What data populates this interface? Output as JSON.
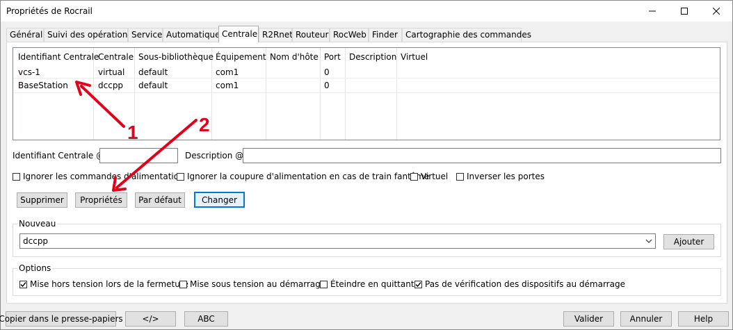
{
  "window": {
    "title": "Propriétés de Rocrail"
  },
  "tabs": [
    {
      "label": "Général"
    },
    {
      "label": "Suivi des opérations"
    },
    {
      "label": "Service"
    },
    {
      "label": "Automatique"
    },
    {
      "label": "Centrale",
      "active": true
    },
    {
      "label": "R2Rnet"
    },
    {
      "label": "Routeur"
    },
    {
      "label": "RocWeb"
    },
    {
      "label": "Finder"
    },
    {
      "label": "Cartographie des commandes"
    }
  ],
  "table": {
    "headers": [
      "Identifiant Centrale",
      "Centrale",
      "Sous-bibliothèque",
      "Équipement",
      "Nom d'hôte",
      "Port",
      "Description",
      "Virtuel"
    ],
    "rows": [
      {
        "id": "vcs-1",
        "centrale": "virtual",
        "sub": "default",
        "equip": "com1",
        "host": "",
        "port": "0",
        "desc": "",
        "virt": ""
      },
      {
        "id": "BaseStation",
        "centrale": "dccpp",
        "sub": "default",
        "equip": "com1",
        "host": "",
        "port": "0",
        "desc": "",
        "virt": ""
      }
    ]
  },
  "form": {
    "id_label": "Identifiant Centrale @",
    "id_value": "",
    "desc_label": "Description @",
    "desc_value": ""
  },
  "checks": {
    "ignore_cmds": {
      "label": "Ignorer les commandes d'alimentation",
      "checked": false
    },
    "ignore_power": {
      "label": "Ignorer la coupure d'alimentation en cas de train fantôme",
      "checked": false
    },
    "virtual": {
      "label": "Virtuel",
      "checked": false
    },
    "invert": {
      "label": "Inverser les portes",
      "checked": false
    }
  },
  "buttons": {
    "delete": "Supprimer",
    "properties": "Propriétés",
    "default": "Par défaut",
    "change": "Changer",
    "add": "Ajouter"
  },
  "nouveau": {
    "title": "Nouveau",
    "selected": "dccpp"
  },
  "options": {
    "title": "Options",
    "power_off": {
      "label": "Mise hors tension lors de la fermeture",
      "checked": true
    },
    "power_on": {
      "label": "Mise sous tension au démarrage",
      "checked": false
    },
    "shutdown": {
      "label": "Éteindre en quittant",
      "checked": false
    },
    "no_check": {
      "label": "Pas de vérification des dispositifs au démarrage",
      "checked": true
    }
  },
  "footer": {
    "copy": "Copier dans le presse-papiers",
    "code": "</>",
    "abc": "ABC",
    "validate": "Valider",
    "cancel": "Annuler",
    "help": "Help"
  },
  "annotations": {
    "arrow1": "1",
    "arrow2": "2",
    "color": "#e3001b"
  },
  "icons": [
    "minimize-icon",
    "maximize-icon",
    "close-icon",
    "chevron-down-icon",
    "checkmark-icon"
  ]
}
